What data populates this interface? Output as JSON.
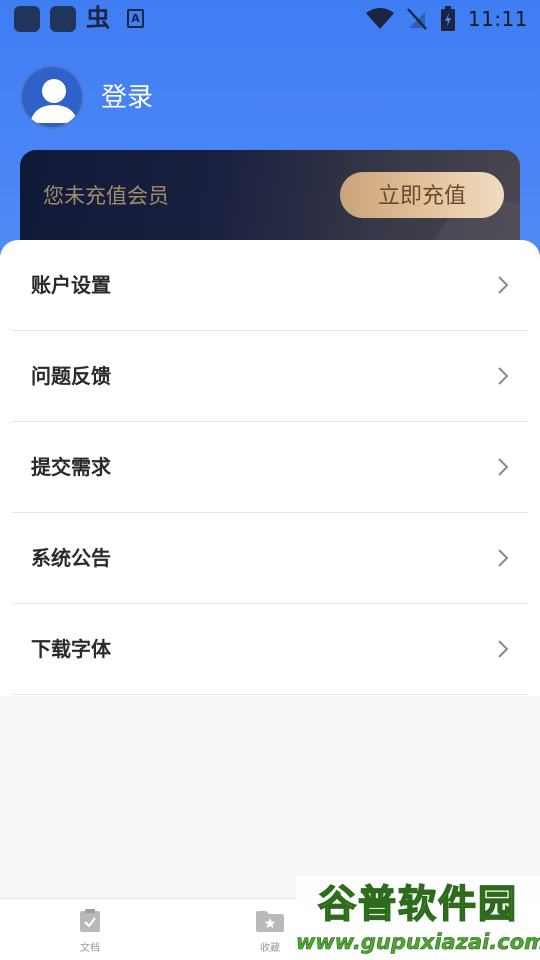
{
  "status_bar": {
    "notification_icons": [
      "app-icon",
      "app-icon",
      "insect-app-icon",
      "font-app-icon"
    ],
    "glyph_app": "虫",
    "font_app_letter": "A",
    "time": "11:11"
  },
  "profile": {
    "login_label": "登录"
  },
  "vip_card": {
    "status_text": "您未充值会员",
    "recharge_label": "立即充值",
    "accent_color": "#e5c49f"
  },
  "menu": {
    "items": [
      {
        "label": "账户设置"
      },
      {
        "label": "问题反馈"
      },
      {
        "label": "提交需求"
      },
      {
        "label": "系统公告"
      },
      {
        "label": "下载字体"
      }
    ]
  },
  "bottom_nav": {
    "items": [
      {
        "label": "文档",
        "icon": "document-check-icon"
      },
      {
        "label": "收藏",
        "icon": "folder-star-icon"
      }
    ]
  },
  "watermark": {
    "title": "谷普软件园",
    "url": "www.gupuxiazai.com"
  },
  "colors": {
    "header_blue": "#3f7df3",
    "card_dark": "#101a38",
    "button_gold": "#e5c49f",
    "watermark_green": "#5fbf3a"
  }
}
